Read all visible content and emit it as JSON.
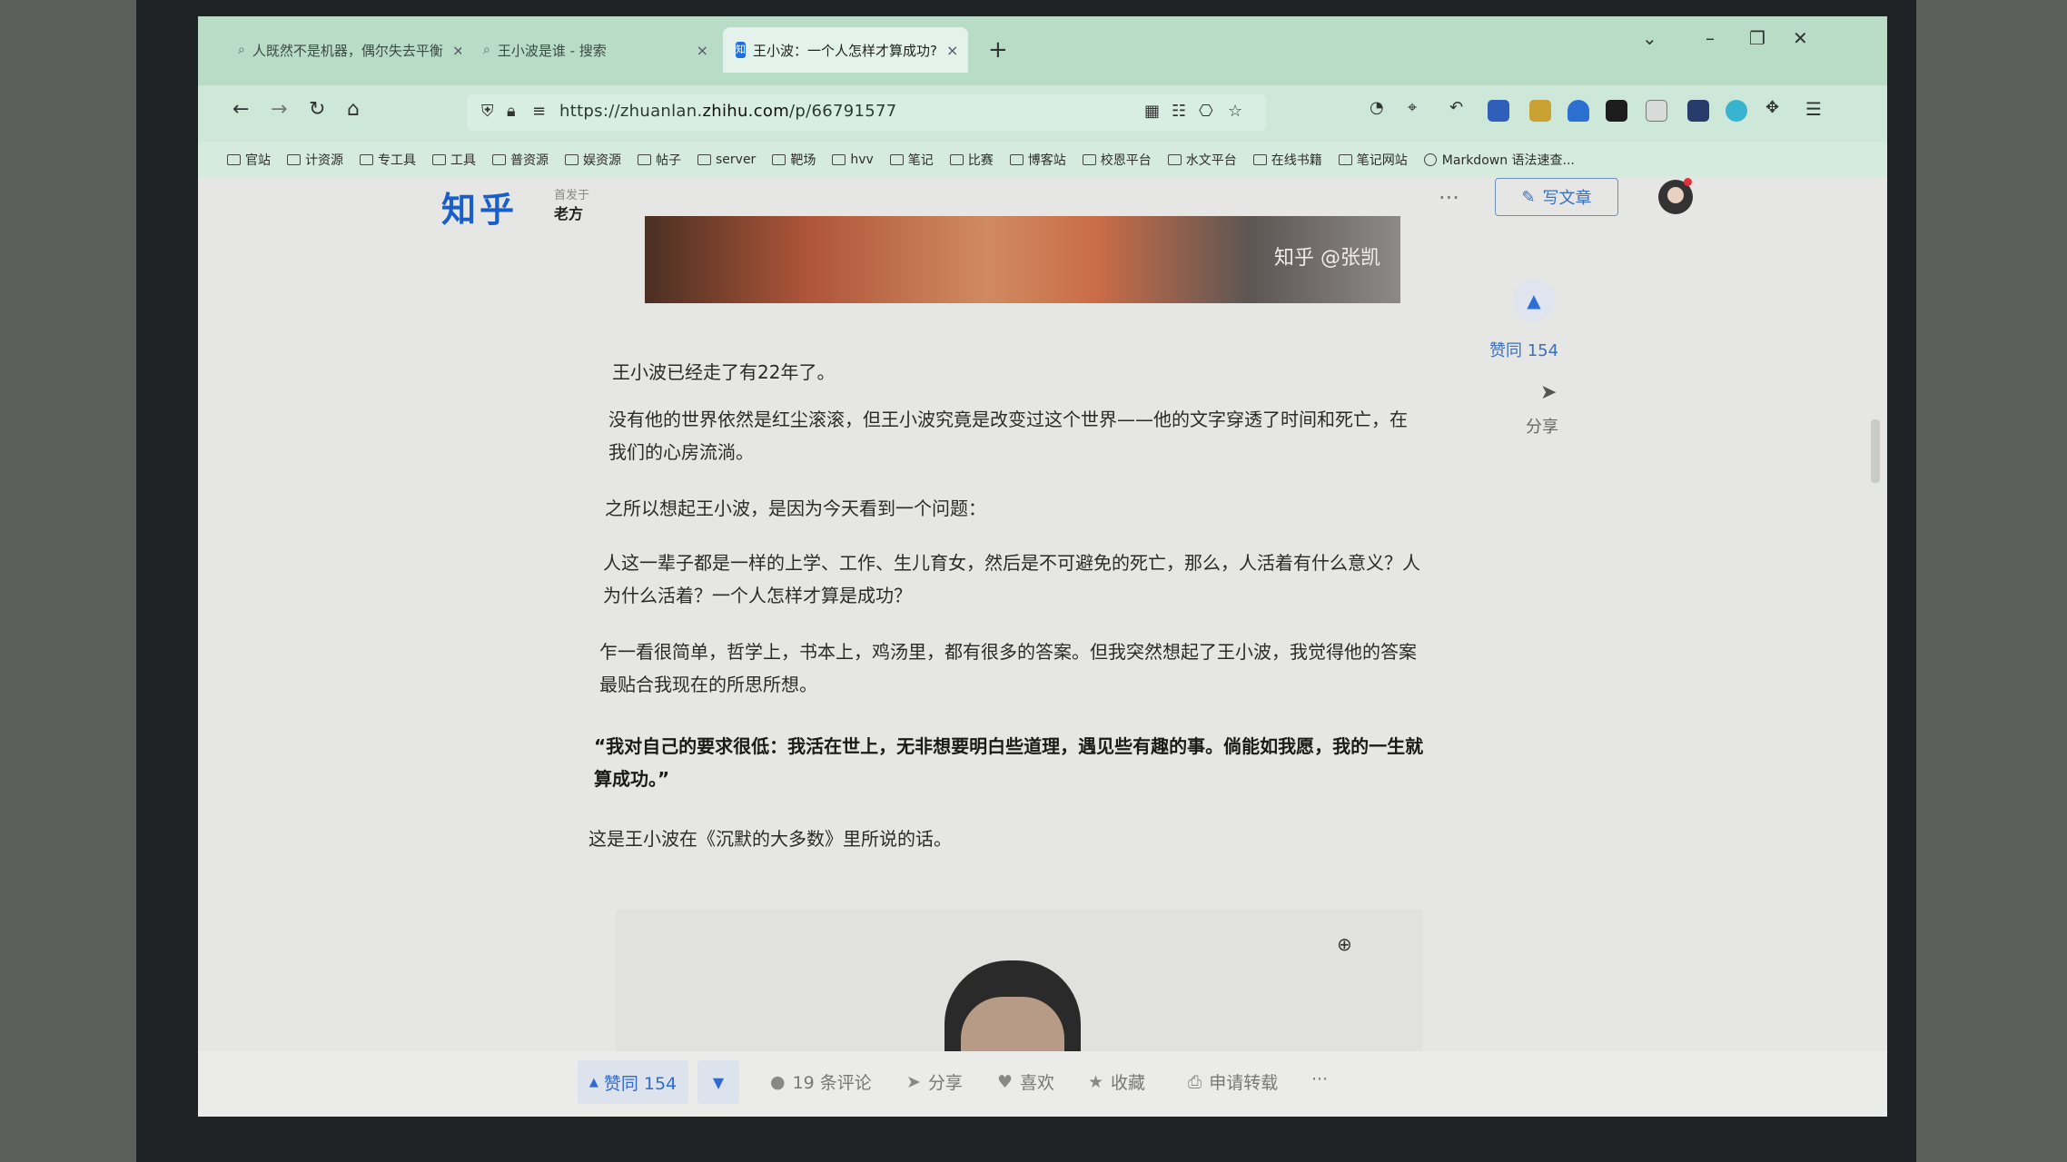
{
  "browser": {
    "tabs": [
      {
        "label": "人既然不是机器，偶尔失去平衡",
        "icon": "search-icon"
      },
      {
        "label": "王小波是谁 - 搜索",
        "icon": "search-icon"
      },
      {
        "label": "王小波：一个人怎样才算成功?",
        "icon": "zhihu-icon",
        "favicon_text": "知"
      }
    ],
    "new_tab": "+",
    "url_prefix": "https://zhuanlan.",
    "url_domain": "zhihu.com",
    "url_path": "/p/66791577",
    "bookmarks": [
      "官站",
      "计资源",
      "专工具",
      "工具",
      "普资源",
      "娱资源",
      "帖子",
      "server",
      "靶场",
      "hvv",
      "笔记",
      "比赛",
      "博客站",
      "校恩平台",
      "水文平台",
      "在线书籍",
      "笔记网站"
    ],
    "bookmark_link": "Markdown 语法速查..."
  },
  "header": {
    "logo": "知乎",
    "first_published": "首发于",
    "column_name": "老方",
    "more": "···",
    "write_label": "写文章"
  },
  "banner": {
    "watermark": "知乎 @张凯"
  },
  "side": {
    "vote_label": "赞同 154",
    "share_label": "分享"
  },
  "article": {
    "paragraphs": [
      "王小波已经走了有22年了。",
      "没有他的世界依然是红尘滚滚，但王小波究竟是改变过这个世界——他的文字穿透了时间和死亡，在我们的心房流淌。",
      "之所以想起王小波，是因为今天看到一个问题：",
      "人这一辈子都是一样的上学、工作、生儿育女，然后是不可避免的死亡，那么，人活着有什么意义？人为什么活着？一个人怎样才算是成功？",
      "乍一看很简单，哲学上，书本上，鸡汤里，都有很多的答案。但我突然想起了王小波，我觉得他的答案最贴合我现在的所思所想。",
      "“我对自己的要求很低：我活在世上，无非想要明白些道理，遇见些有趣的事。倘能如我愿，我的一生就算成功。”",
      "这是王小波在《沉默的大多数》里所说的话。"
    ]
  },
  "actions": {
    "vote": "赞同 154",
    "comments": "19 条评论",
    "share": "分享",
    "like": "喜欢",
    "collect": "收藏",
    "repost": "申请转载",
    "more": "···"
  }
}
